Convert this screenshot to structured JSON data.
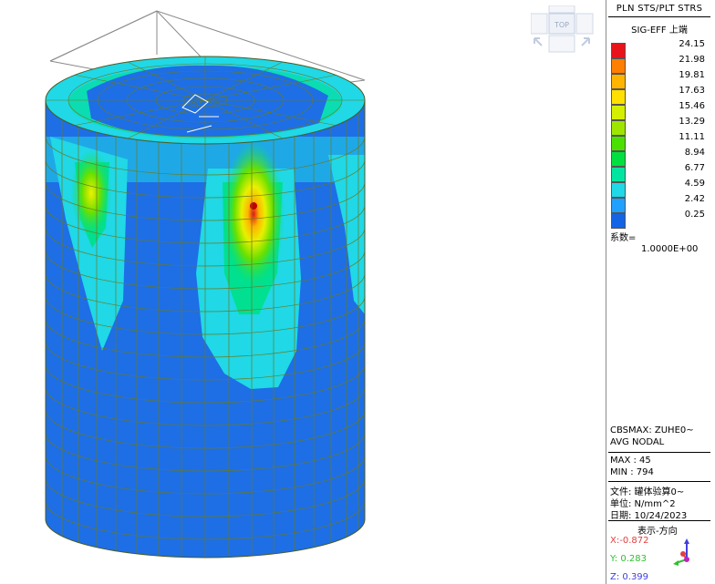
{
  "legend": {
    "title": "PLN STS/PLT STRS",
    "subtitle": "SIG-EFF 上端",
    "levels": [
      "24.15",
      "21.98",
      "19.81",
      "17.63",
      "15.46",
      "13.29",
      "11.11",
      "8.94",
      "6.77",
      "4.59",
      "2.42",
      "0.25"
    ],
    "colors": [
      "#e8141a",
      "#ff7f00",
      "#ffb400",
      "#ffe000",
      "#d4f000",
      "#9ee600",
      "#4ae000",
      "#00e040",
      "#00e6a0",
      "#20d8e6",
      "#20a0ff",
      "#1464e6"
    ],
    "factor_label": "系数=",
    "factor_value": "1.0000E+00",
    "cbs_max": "CBSMAX: ZUHE0~",
    "avg": "AVG NODAL",
    "max_label": "MAX : 45",
    "min_label": "MIN : 794",
    "file_label": "文件: 罐体验算0~",
    "unit_label": "单位: N/mm^2",
    "date_label": "日期: 10/24/2023",
    "view_dir_label": "表示-方向",
    "x_dir": "X:-0.872",
    "y_dir": "Y: 0.283",
    "z_dir": "Z: 0.399"
  },
  "viewcube": {
    "top_label": "TOP"
  },
  "colors": {
    "base_blue": "#1e6ee6",
    "cyan": "#20d8e6",
    "mesh_line": "#6a7a20",
    "x_axis": "#e04040",
    "y_axis": "#30c030",
    "z_axis": "#4040e0"
  }
}
